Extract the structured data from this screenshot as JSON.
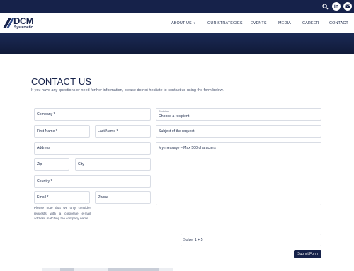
{
  "header": {
    "icons": [
      "search-icon",
      "linkedin-icon",
      "mail-icon"
    ],
    "linkedin_glyph": "in"
  },
  "logo": {
    "word": "DCM",
    "sub": "Systematic"
  },
  "nav": {
    "items": [
      {
        "label": "ABOUT US",
        "has_caret": true
      },
      {
        "label": "OUR STRATEGIES"
      },
      {
        "label": "EVENTS"
      },
      {
        "label": "MEDIA"
      },
      {
        "label": "CAREER"
      },
      {
        "label": "CONTACT"
      }
    ]
  },
  "page": {
    "title": "CONTACT US",
    "intro": "If you have any questions or need further information, please do not hesitate to contact us using the form below."
  },
  "form": {
    "company": "Company *",
    "first_name": "First Name *",
    "last_name": "Last Name *",
    "address": "Address",
    "zip": "Zip",
    "city": "City",
    "country": "Country *",
    "email": "Email *",
    "phone": "Phone",
    "recipient_label": "Recipient",
    "recipient_value": "Choose a recipient",
    "subject": "Subject of the request",
    "message": "My message – Max 500 characters",
    "captcha": "Solve: 1 + 5",
    "email_note": "Please note that we only consider requests with a corporate e-mail address matching the company name.",
    "submit": "Submit Form"
  },
  "colors": {
    "navy": "#16224a",
    "border": "#d9dde5"
  }
}
